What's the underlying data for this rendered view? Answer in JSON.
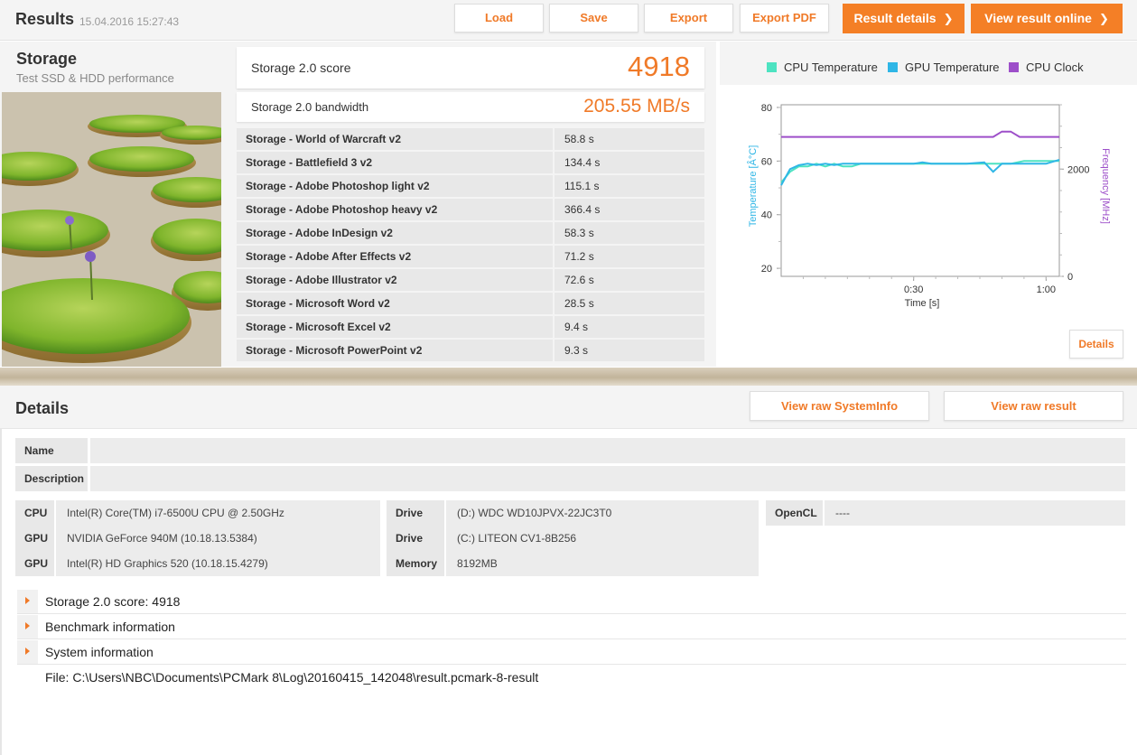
{
  "header": {
    "title": "Results",
    "date": "15.04.2016 15:27:43",
    "buttons": {
      "load": "Load",
      "save": "Save",
      "export": "Export",
      "export_pdf": "Export PDF"
    },
    "result_details": "Result details",
    "view_online": "View result online"
  },
  "storage": {
    "name": "Storage",
    "subtitle": "Test SSD & HDD performance",
    "score_label": "Storage 2.0 score",
    "score_value": "4918",
    "bandwidth_label": "Storage 2.0 bandwidth",
    "bandwidth_value": "205.55 MB/s",
    "tests": [
      {
        "name": "Storage - World of Warcraft v2",
        "value": "58.8 s"
      },
      {
        "name": "Storage - Battlefield 3 v2",
        "value": "134.4 s"
      },
      {
        "name": "Storage - Adobe Photoshop light v2",
        "value": "115.1 s"
      },
      {
        "name": "Storage - Adobe Photoshop heavy v2",
        "value": "366.4 s"
      },
      {
        "name": "Storage - Adobe InDesign v2",
        "value": "58.3 s"
      },
      {
        "name": "Storage - Adobe After Effects v2",
        "value": "71.2 s"
      },
      {
        "name": "Storage - Adobe Illustrator v2",
        "value": "72.6 s"
      },
      {
        "name": "Storage - Microsoft Word v2",
        "value": "28.5 s"
      },
      {
        "name": "Storage - Microsoft Excel v2",
        "value": "9.4 s"
      },
      {
        "name": "Storage - Microsoft PowerPoint v2",
        "value": "9.3 s"
      }
    ]
  },
  "chart_data": {
    "type": "line",
    "legend": [
      {
        "name": "CPU Temperature",
        "color": "#4de3c1"
      },
      {
        "name": "GPU Temperature",
        "color": "#2fb6e6"
      },
      {
        "name": "CPU Clock",
        "color": "#9d4fc9"
      }
    ],
    "xlabel": "Time [s]",
    "ylabel_left": "Temperature [Â°C]",
    "ylabel_right": "Frequency [MHz]",
    "x_ticks": [
      "0:30",
      "1:00"
    ],
    "y_left_ticks": [
      "80",
      "60",
      "40",
      "20"
    ],
    "y_right_ticks": [
      "2000",
      "0"
    ],
    "xlim": [
      0,
      63
    ],
    "ylim_left": [
      17,
      81
    ],
    "ylim_right": [
      0,
      3200
    ],
    "series": [
      {
        "name": "CPU Temperature",
        "axis": "left",
        "color": "#4de3c1",
        "x": [
          0,
          2,
          4,
          6,
          8,
          10,
          12,
          14,
          16,
          18,
          20,
          25,
          30,
          35,
          40,
          45,
          50,
          52,
          55,
          60,
          63
        ],
        "y": [
          52,
          56,
          58,
          58,
          59,
          58,
          59,
          58,
          58,
          59,
          59,
          59,
          59,
          59,
          59,
          59,
          59,
          59,
          60,
          60,
          60
        ]
      },
      {
        "name": "GPU Temperature",
        "axis": "left",
        "color": "#2fb6e6",
        "x": [
          0,
          2,
          4,
          6,
          8,
          10,
          12,
          14,
          16,
          18,
          20,
          25,
          30,
          32,
          34,
          38,
          42,
          46,
          48,
          50,
          52,
          55,
          60,
          63
        ],
        "y": [
          51,
          57,
          58.5,
          59,
          58.5,
          59,
          58.5,
          59,
          59,
          59,
          59,
          59,
          59,
          59.5,
          59,
          59,
          59,
          59.5,
          56,
          59,
          59,
          59,
          59,
          60.5
        ]
      },
      {
        "name": "CPU Clock",
        "axis": "right",
        "color": "#9d4fc9",
        "x": [
          0,
          10,
          20,
          30,
          40,
          48,
          50,
          52,
          54,
          56,
          63
        ],
        "y": [
          2600,
          2600,
          2600,
          2600,
          2600,
          2600,
          2700,
          2700,
          2600,
          2600,
          2600
        ]
      }
    ]
  },
  "chart_panel": {
    "details_button": "Details"
  },
  "details": {
    "title": "Details",
    "view_raw_sysinfo": "View raw SystemInfo",
    "view_raw_result": "View raw result",
    "name_label": "Name",
    "name_value": "",
    "description_label": "Description",
    "description_value": "",
    "col1": [
      {
        "k": "CPU",
        "v": "Intel(R) Core(TM) i7-6500U CPU @ 2.50GHz"
      },
      {
        "k": "GPU",
        "v": "NVIDIA GeForce 940M (10.18.13.5384)"
      },
      {
        "k": "GPU",
        "v": "Intel(R) HD Graphics 520 (10.18.15.4279)"
      }
    ],
    "col2": [
      {
        "k": "Drive",
        "v": "(D:) WDC WD10JPVX-22JC3T0"
      },
      {
        "k": "Drive",
        "v": "(C:) LITEON CV1-8B256"
      },
      {
        "k": "Memory",
        "v": "8192MB"
      }
    ],
    "col3": [
      {
        "k": "OpenCL",
        "v": "----"
      }
    ],
    "expanders": [
      "Storage 2.0 score: 4918",
      "Benchmark information",
      "System information"
    ],
    "file_path": "File: C:\\Users\\NBC\\Documents\\PCMark 8\\Log\\20160415_142048\\result.pcmark-8-result"
  }
}
